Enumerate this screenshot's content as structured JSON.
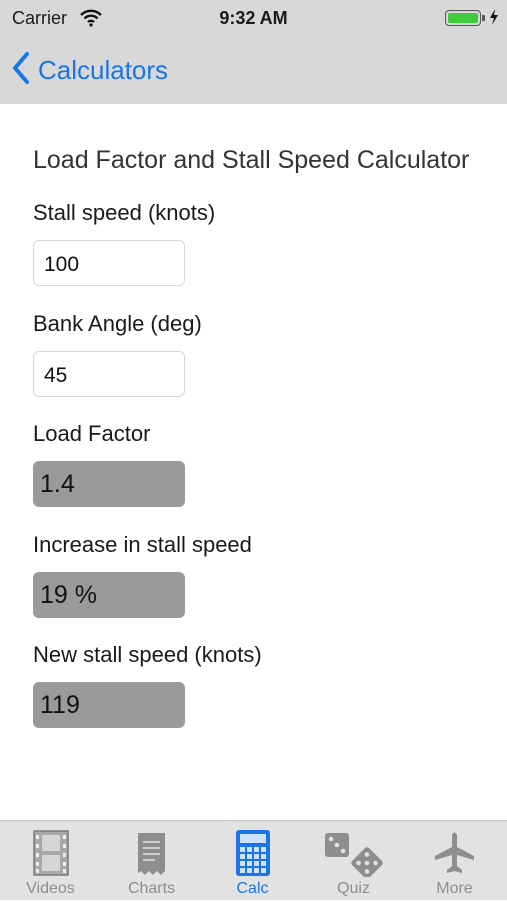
{
  "status_bar": {
    "carrier": "Carrier",
    "time": "9:32 AM",
    "battery_level": 1.0
  },
  "nav": {
    "back_label": "Calculators"
  },
  "calculator": {
    "title": "Load Factor and Stall Speed Calculator",
    "fields": {
      "stall_speed": {
        "label": "Stall speed (knots)",
        "value": "100"
      },
      "bank_angle": {
        "label": "Bank Angle (deg)",
        "value": "45"
      }
    },
    "outputs": {
      "load_factor": {
        "label": "Load Factor",
        "value": "1.4"
      },
      "stall_increase": {
        "label": "Increase in stall speed",
        "value": "19 %"
      },
      "new_stall_speed": {
        "label": "New stall speed (knots)",
        "value": "119"
      }
    }
  },
  "tabs": [
    {
      "label": "Videos",
      "icon": "film-icon"
    },
    {
      "label": "Charts",
      "icon": "chart-page-icon"
    },
    {
      "label": "Calc",
      "icon": "calculator-icon",
      "active": true
    },
    {
      "label": "Quiz",
      "icon": "dice-icon"
    },
    {
      "label": "More",
      "icon": "airplane-icon"
    }
  ],
  "colors": {
    "accent": "#1a76e8",
    "bars": "#d8d8d8",
    "output_bg": "#9a9a9a",
    "tab_inactive": "#8e8e8e",
    "battery": "#3ecb3e"
  }
}
